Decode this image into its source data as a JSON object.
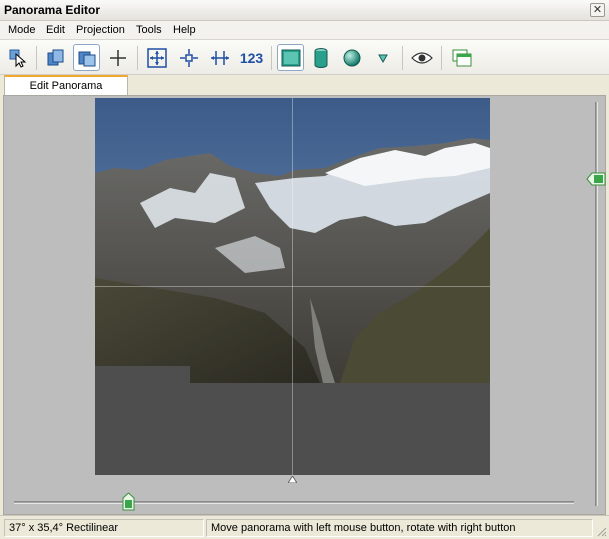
{
  "window": {
    "title": "Panorama Editor",
    "close_glyph": "✕"
  },
  "menu": [
    "Mode",
    "Edit",
    "Projection",
    "Tools",
    "Help"
  ],
  "toolbar": {
    "buttons": [
      {
        "icon": "select-arrow-icon"
      },
      {
        "icon": "images-icon"
      },
      {
        "icon": "drag-images-icon",
        "active": true
      },
      {
        "icon": "crosshair-icon"
      },
      {
        "icon": "fit-icon"
      },
      {
        "icon": "center-icon"
      },
      {
        "icon": "straighten-icon"
      },
      {
        "icon": "numbers-icon",
        "label": "123"
      },
      {
        "icon": "rectilinear-icon",
        "active": true
      },
      {
        "icon": "cylinder-icon"
      },
      {
        "icon": "sphere-icon"
      },
      {
        "icon": "more-projections-icon"
      },
      {
        "icon": "preview-eye-icon"
      },
      {
        "icon": "new-window-icon"
      }
    ]
  },
  "tabs": [
    {
      "label": "Edit Panorama",
      "active": true
    }
  ],
  "canvas": {
    "background": "#bdbdbd",
    "uncovered_color": "#4d4e4d"
  },
  "status": {
    "fov": "37° x 35,4° Rectilinear",
    "hint": "Move panorama with left mouse button, rotate with right button"
  },
  "colors": {
    "accent_tab": "#f0a830",
    "toolbar_blue": "#1f4fa3",
    "slider_thumb": "#3aa64a"
  }
}
